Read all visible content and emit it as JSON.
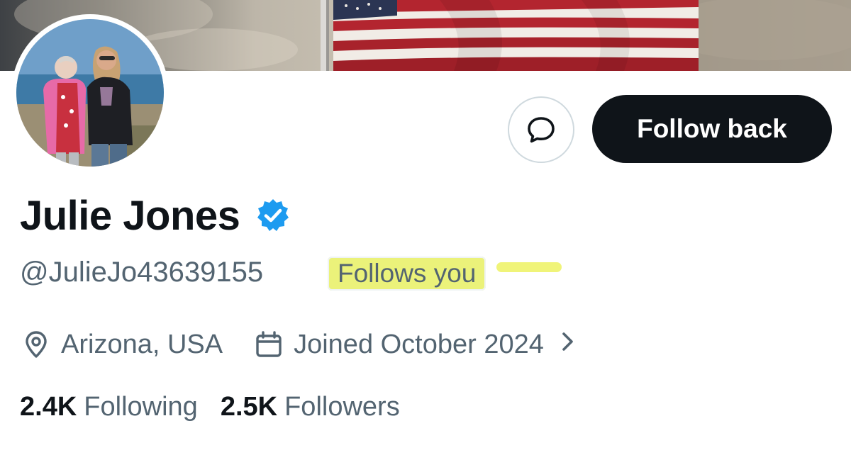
{
  "profile": {
    "display_name": "Julie Jones",
    "handle": "@JulieJo43639155",
    "follows_you_label": "Follows you",
    "verified": true,
    "location": "Arizona, USA",
    "joined": "Joined October 2024",
    "following_count": "2.4K",
    "following_label": "Following",
    "followers_count": "2.5K",
    "followers_label": "Followers"
  },
  "actions": {
    "follow_back_label": "Follow back",
    "message_icon": "message-bubble-icon"
  },
  "icons": {
    "location": "location-pin-icon",
    "calendar": "calendar-icon",
    "chevron": "chevron-right-icon",
    "verified": "verified-badge-icon"
  },
  "colors": {
    "primary_text": "#0f1419",
    "secondary_text": "#536471",
    "verified_blue": "#1d9bf0",
    "button_dark": "#0f1419",
    "highlight": "#ebf27a",
    "border": "#cfd9de"
  }
}
